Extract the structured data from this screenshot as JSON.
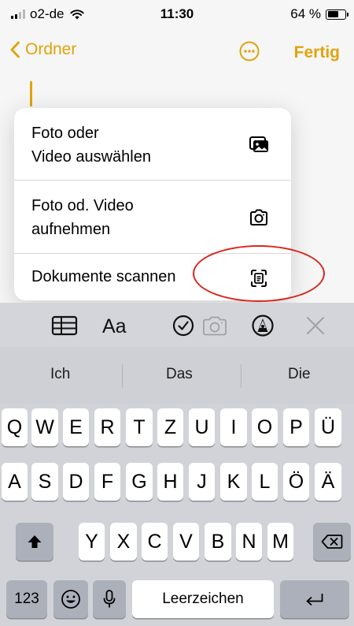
{
  "status_bar": {
    "carrier": "o2-de",
    "time": "11:30",
    "battery": "64 %",
    "battery_level": 0.64
  },
  "nav": {
    "back_label": "Ordner",
    "done_label": "Fertig"
  },
  "menu": {
    "items": [
      {
        "label_line1": "Foto oder",
        "label_line2": "Video auswählen",
        "icon": "photo-gallery-icon"
      },
      {
        "label_line1": "Foto od. Video",
        "label_line2": "aufnehmen",
        "icon": "camera-icon"
      },
      {
        "label": "Dokumente scannen",
        "icon": "document-scan-icon"
      }
    ]
  },
  "toolbar": {
    "format_label": "Aa",
    "icons": [
      "table-icon",
      "format-text-icon",
      "checklist-icon",
      "camera-icon",
      "markup-pen-icon",
      "close-icon"
    ]
  },
  "keyboard": {
    "suggestions": [
      "Ich",
      "Das",
      "Die"
    ],
    "row1": [
      "Q",
      "W",
      "E",
      "R",
      "T",
      "Z",
      "U",
      "I",
      "O",
      "P",
      "Ü"
    ],
    "row2": [
      "A",
      "S",
      "D",
      "F",
      "G",
      "H",
      "J",
      "K",
      "L",
      "Ö",
      "Ä"
    ],
    "row3": [
      "Y",
      "X",
      "C",
      "V",
      "B",
      "N",
      "M"
    ],
    "numbers_label": "123",
    "space_label": "Leerzeichen"
  },
  "colors": {
    "accent": "#E0A40C",
    "annotation": "#D9261C"
  }
}
